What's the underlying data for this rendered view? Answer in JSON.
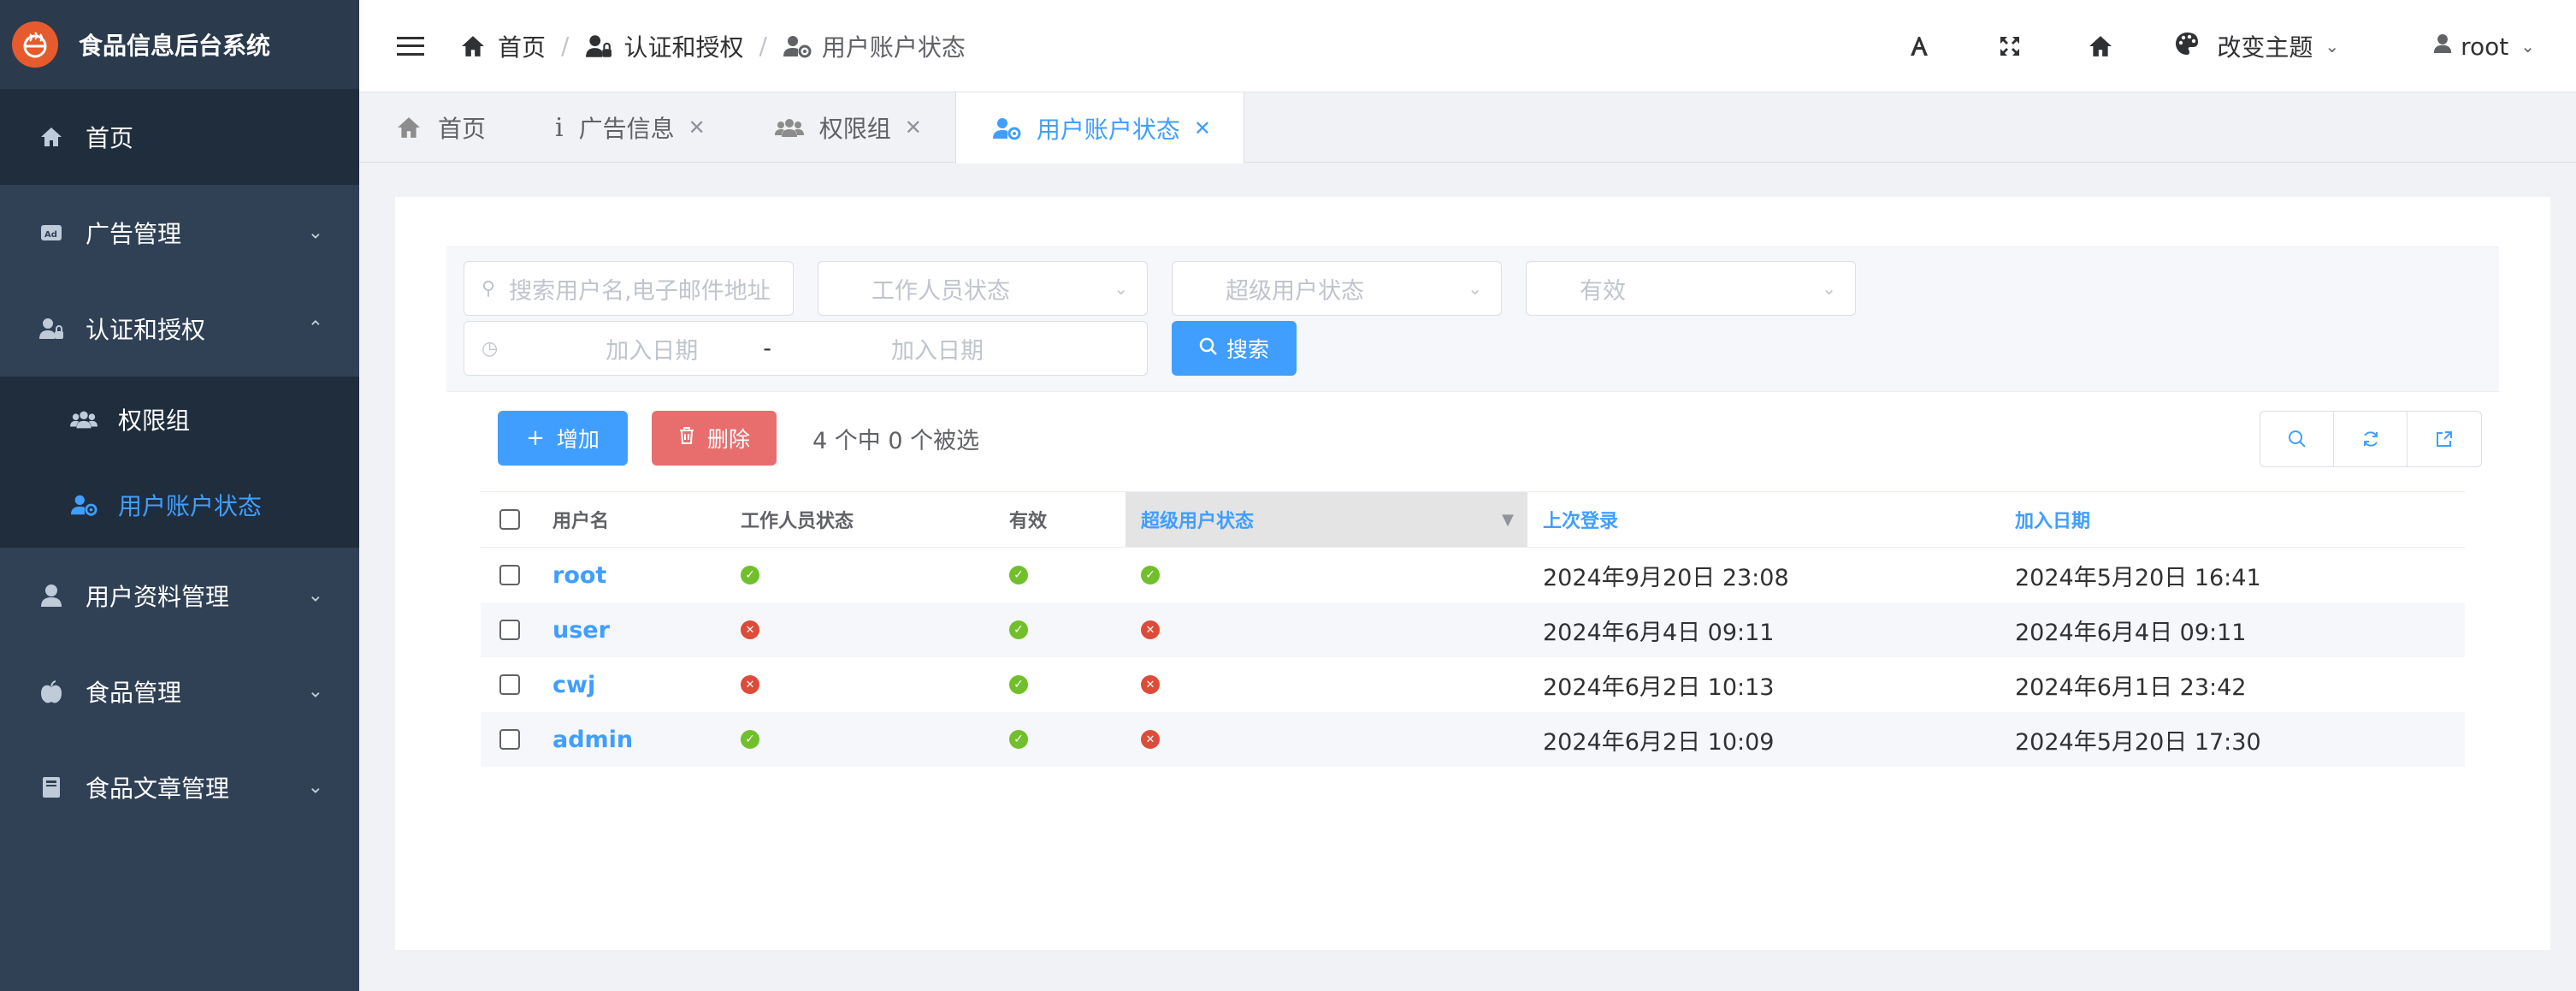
{
  "app": {
    "title": "食品信息后台系统"
  },
  "sidebar": {
    "items": [
      {
        "label": "首页",
        "icon": "home-icon"
      },
      {
        "label": "广告管理",
        "icon": "ad-icon"
      },
      {
        "label": "认证和授权",
        "icon": "user-lock-icon"
      },
      {
        "label": "用户资料管理",
        "icon": "user-icon"
      },
      {
        "label": "食品管理",
        "icon": "apple-icon"
      },
      {
        "label": "食品文章管理",
        "icon": "book-icon"
      }
    ],
    "subitems": [
      {
        "label": "权限组",
        "icon": "users-icon"
      },
      {
        "label": "用户账户状态",
        "icon": "user-cog-icon",
        "active": true
      }
    ]
  },
  "breadcrumb": [
    {
      "label": "首页"
    },
    {
      "label": "认证和授权"
    },
    {
      "label": "用户账户状态"
    }
  ],
  "header": {
    "theme_label": "改变主题",
    "user": "root"
  },
  "tabs": [
    {
      "label": "首页"
    },
    {
      "label": "广告信息"
    },
    {
      "label": "权限组"
    },
    {
      "label": "用户账户状态"
    }
  ],
  "filters": {
    "search_placeholder": "搜索用户名,电子邮件地址",
    "staff_placeholder": "工作人员状态",
    "superuser_placeholder": "超级用户状态",
    "active_placeholder": "有效",
    "date_start_placeholder": "加入日期",
    "date_sep": "-",
    "date_end_placeholder": "加入日期",
    "search_button": "搜索"
  },
  "actions": {
    "add": "增加",
    "delete": "删除",
    "selection": "4 个中 0 个被选"
  },
  "table": {
    "columns": [
      "用户名",
      "工作人员状态",
      "有效",
      "超级用户状态",
      "上次登录",
      "加入日期"
    ],
    "rows": [
      {
        "username": "root",
        "staff": true,
        "active": true,
        "superuser": true,
        "last_login": "2024年9月20日 23:08",
        "date_joined": "2024年5月20日 16:41"
      },
      {
        "username": "user",
        "staff": false,
        "active": true,
        "superuser": false,
        "last_login": "2024年6月4日 09:11",
        "date_joined": "2024年6月4日 09:11"
      },
      {
        "username": "cwj",
        "staff": false,
        "active": true,
        "superuser": false,
        "last_login": "2024年6月2日 10:13",
        "date_joined": "2024年6月1日 23:42"
      },
      {
        "username": "admin",
        "staff": true,
        "active": true,
        "superuser": false,
        "last_login": "2024年6月2日 10:09",
        "date_joined": "2024年5月20日 17:30"
      }
    ]
  },
  "colors": {
    "sidebar": "#304156",
    "accent": "#409eff",
    "danger": "#e86e6e",
    "ok": "#70bf2b",
    "no": "#dd4b39"
  }
}
